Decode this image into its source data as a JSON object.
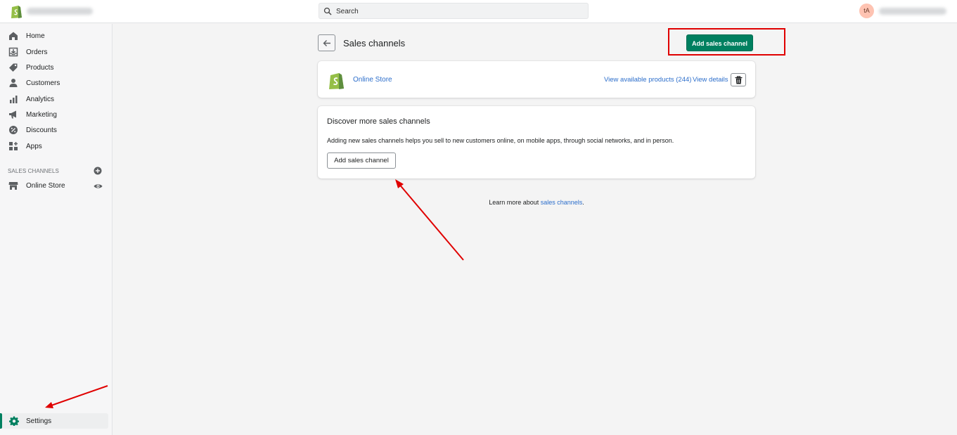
{
  "topbar": {
    "search_placeholder": "Search",
    "avatar_initials": "tA"
  },
  "sidebar": {
    "items": [
      {
        "label": "Home",
        "icon": "home-icon"
      },
      {
        "label": "Orders",
        "icon": "orders-icon"
      },
      {
        "label": "Products",
        "icon": "tag-icon"
      },
      {
        "label": "Customers",
        "icon": "person-icon"
      },
      {
        "label": "Analytics",
        "icon": "bar-chart-icon"
      },
      {
        "label": "Marketing",
        "icon": "megaphone-icon"
      },
      {
        "label": "Discounts",
        "icon": "discount-icon"
      },
      {
        "label": "Apps",
        "icon": "apps-icon"
      }
    ],
    "section_title": "SALES CHANNELS",
    "channel_label": "Online Store",
    "settings_label": "Settings"
  },
  "main": {
    "page_title": "Sales channels",
    "primary_button": "Add sales channel",
    "store_card": {
      "name": "Online Store",
      "view_products": "View available products (244)",
      "view_details": "View details"
    },
    "discover_card": {
      "title": "Discover more sales channels",
      "text": "Adding new sales channels helps you sell to new customers online, on mobile apps, through social networks, and in person.",
      "button": "Add sales channel"
    },
    "learn_more_prefix": "Learn more about ",
    "learn_more_link": "sales channels",
    "learn_more_suffix": "."
  },
  "colors": {
    "accent": "#008060",
    "link": "#2c6ecb",
    "annotation": "#e00000"
  }
}
